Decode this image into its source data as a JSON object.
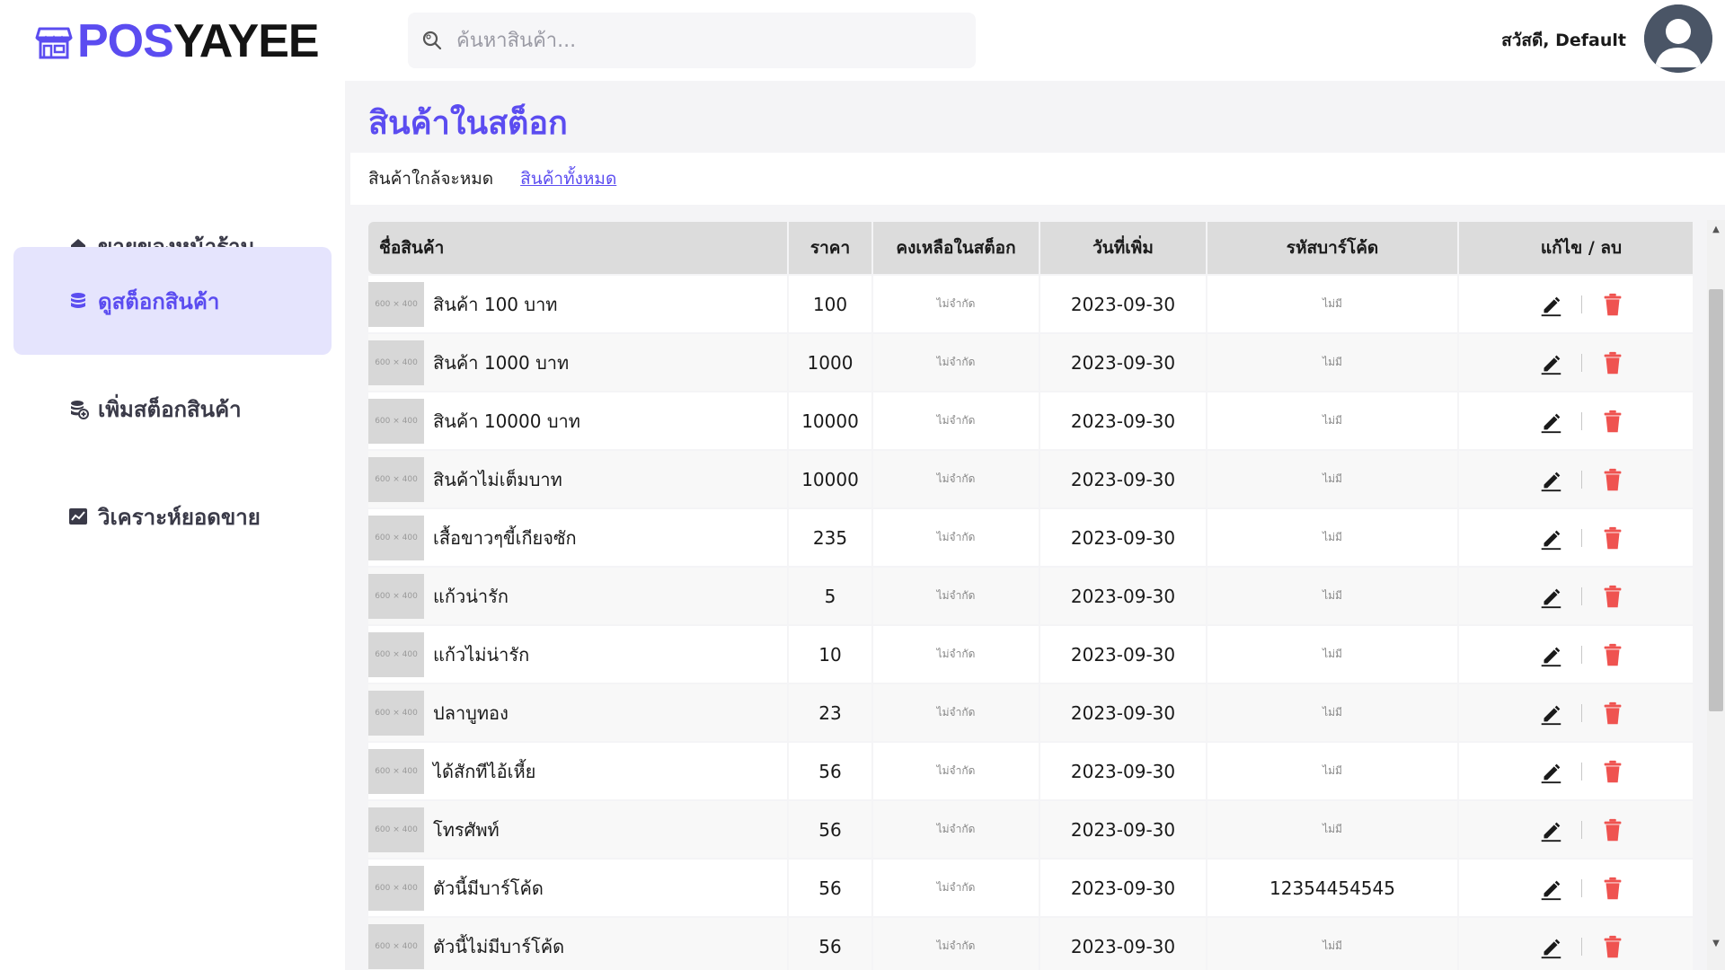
{
  "header": {
    "logo_part1": "POS",
    "logo_part2": "YAYEE",
    "search_placeholder": "ค้นหาสินค้า...",
    "greeting": "สวัสดี, Default"
  },
  "sidebar": {
    "items": [
      {
        "label": "ขายของหน้าร้าน",
        "icon": "home-icon",
        "active": false
      },
      {
        "label": "ดูสต็อกสินค้า",
        "icon": "database-icon",
        "active": true
      },
      {
        "label": "เพิ่มสต็อกสินค้า",
        "icon": "database-add-icon",
        "active": false
      },
      {
        "label": "วิเคราะห์ยอดขาย",
        "icon": "chart-icon",
        "active": false
      }
    ]
  },
  "main": {
    "title": "สินค้าในสต็อก",
    "tabs": [
      {
        "label": "สินค้าใกล้จะหมด"
      },
      {
        "label": "สินค้าทั้งหมด"
      }
    ],
    "table": {
      "headers": [
        "ชื่อสินค้า",
        "ราคา",
        "คงเหลือในสต็อก",
        "วันที่เพิ่ม",
        "รหัสบาร์โค้ด",
        "แก้ไข / ลบ"
      ],
      "thumb_text": "600 × 400",
      "rows": [
        {
          "name": "สินค้า 100 บาท",
          "price": "100",
          "stock": "ไม่จำกัด",
          "date": "2023-09-30",
          "barcode": "ไม่มี"
        },
        {
          "name": "สินค้า 1000 บาท",
          "price": "1000",
          "stock": "ไม่จำกัด",
          "date": "2023-09-30",
          "barcode": "ไม่มี"
        },
        {
          "name": "สินค้า 10000 บาท",
          "price": "10000",
          "stock": "ไม่จำกัด",
          "date": "2023-09-30",
          "barcode": "ไม่มี"
        },
        {
          "name": "สินค้าไม่เต็มบาท",
          "price": "10000",
          "stock": "ไม่จำกัด",
          "date": "2023-09-30",
          "barcode": "ไม่มี"
        },
        {
          "name": "เสื้อขาวๆขี้เกียจซัก",
          "price": "235",
          "stock": "ไม่จำกัด",
          "date": "2023-09-30",
          "barcode": "ไม่มี"
        },
        {
          "name": "แก้วน่ารัก",
          "price": "5",
          "stock": "ไม่จำกัด",
          "date": "2023-09-30",
          "barcode": "ไม่มี"
        },
        {
          "name": "แก้วไม่น่ารัก",
          "price": "10",
          "stock": "ไม่จำกัด",
          "date": "2023-09-30",
          "barcode": "ไม่มี"
        },
        {
          "name": "ปลาบูทอง",
          "price": "23",
          "stock": "ไม่จำกัด",
          "date": "2023-09-30",
          "barcode": "ไม่มี"
        },
        {
          "name": "ได้สักทีไอ้เหี้ย",
          "price": "56",
          "stock": "ไม่จำกัด",
          "date": "2023-09-30",
          "barcode": "ไม่มี"
        },
        {
          "name": "โทรศัพท์",
          "price": "56",
          "stock": "ไม่จำกัด",
          "date": "2023-09-30",
          "barcode": "ไม่มี"
        },
        {
          "name": "ตัวนี้มีบาร์โค้ด",
          "price": "56",
          "stock": "ไม่จำกัด",
          "date": "2023-09-30",
          "barcode": "12354454545"
        },
        {
          "name": "ตัวนี้ไม่มีบาร์โค้ด",
          "price": "56",
          "stock": "ไม่จำกัด",
          "date": "2023-09-30",
          "barcode": "ไม่มี"
        }
      ]
    }
  },
  "colors": {
    "accent": "#5b4cf0",
    "active_bg": "#e5e4fd",
    "delete_red": "#ef5350"
  }
}
